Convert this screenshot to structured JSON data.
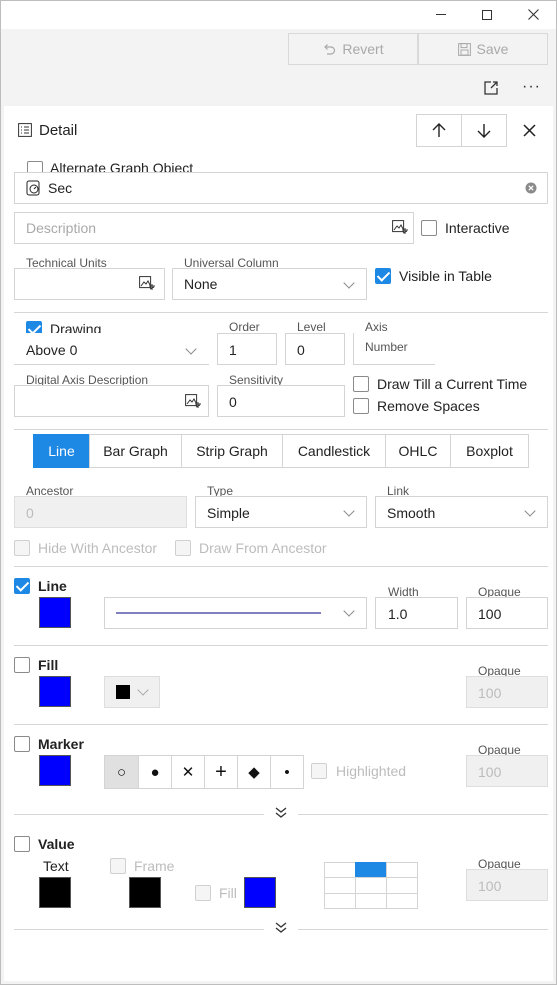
{
  "window": {
    "minimize_glyph": "—",
    "maximize_glyph": "☐",
    "close_glyph": "✕"
  },
  "toolbar": {
    "revert_label": "Revert",
    "save_label": "Save",
    "more_glyph": "···"
  },
  "detail": {
    "title": "Detail",
    "alternate_graph_object": {
      "label": "Alternate Graph Object",
      "checked": false
    },
    "name_value": "Sec",
    "description_placeholder": "Description",
    "interactive": {
      "label": "Interactive",
      "checked": false
    },
    "technical_units": {
      "label": "Technical Units",
      "value": ""
    },
    "universal_column": {
      "label": "Universal Column",
      "value": "None"
    },
    "visible_in_table": {
      "label": "Visible in Table",
      "checked": true
    }
  },
  "drawing": {
    "drawing": {
      "label": "Drawing",
      "checked": true,
      "value": "Above 0"
    },
    "order": {
      "label": "Order",
      "value": "1"
    },
    "level": {
      "label": "Level",
      "value": "0"
    },
    "axis": {
      "label": "Axis",
      "value": "Number"
    },
    "digital_axis_description": {
      "label": "Digital Axis Description",
      "value": ""
    },
    "sensitivity": {
      "label": "Sensitivity",
      "value": "0"
    },
    "draw_till_current_time": {
      "label": "Draw Till a Current Time",
      "checked": false
    },
    "remove_spaces": {
      "label": "Remove Spaces",
      "checked": false
    }
  },
  "tabs": [
    "Line",
    "Bar Graph",
    "Strip Graph",
    "Candlestick",
    "OHLC",
    "Boxplot"
  ],
  "active_tab": "Line",
  "line_options": {
    "ancestor": {
      "label": "Ancestor",
      "value": "0"
    },
    "type": {
      "label": "Type",
      "value": "Simple"
    },
    "link": {
      "label": "Link",
      "value": "Smooth"
    },
    "hide_with_ancestor": {
      "label": "Hide With Ancestor",
      "checked": false
    },
    "draw_from_ancestor": {
      "label": "Draw From Ancestor",
      "checked": false
    }
  },
  "line_section": {
    "label": "Line",
    "checked": true,
    "color": "#0000ff",
    "line_color": "#8080c0",
    "width": {
      "label": "Width",
      "value": "1.0"
    },
    "opaque": {
      "label": "Opaque",
      "value": "100"
    }
  },
  "fill_section": {
    "label": "Fill",
    "checked": false,
    "color": "#0000ff",
    "pattern_color": "#000000",
    "opaque": {
      "label": "Opaque",
      "value": "100"
    }
  },
  "marker_section": {
    "label": "Marker",
    "checked": false,
    "color": "#0000ff",
    "shapes": [
      "○",
      "●",
      "✕",
      "+",
      "◆",
      "•"
    ],
    "selected_shape": "○",
    "highlighted": {
      "label": "Highlighted",
      "checked": false
    },
    "opaque": {
      "label": "Opaque",
      "value": "100"
    }
  },
  "value_section": {
    "label": "Value",
    "checked": false,
    "text_label": "Text",
    "text_color": "#000000",
    "frame": {
      "label": "Frame",
      "checked": false,
      "color": "#000000"
    },
    "fill": {
      "label": "Fill",
      "checked": false,
      "color": "#0000ff"
    },
    "alignment_selected": "top-center",
    "opaque": {
      "label": "Opaque",
      "value": "100"
    }
  },
  "colors": {
    "accent": "#1e88e5",
    "border": "#d4d4d4",
    "disabled_text": "#bcbcbc"
  }
}
